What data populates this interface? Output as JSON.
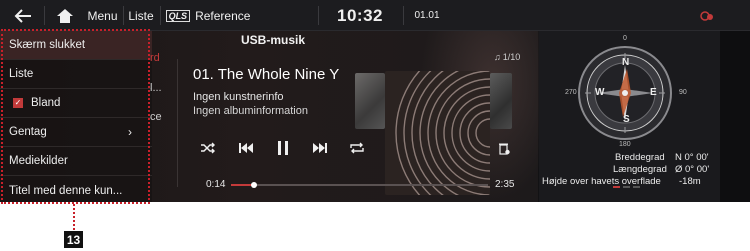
{
  "topbar": {
    "menu_label": "Menu",
    "list_label": "Liste",
    "qls_badge": "QLS",
    "reference_label": "Reference",
    "clock": "10:32",
    "date": "01.01",
    "back_icon": "back-arrow-icon",
    "home_icon": "home-icon",
    "connectivity_icon": "connectivity-status-icon"
  },
  "media": {
    "source_title": "USB-musik",
    "track_count": "1/10",
    "track_title": "01. The Whole Nine Y",
    "artist": "Ingen kunstnerinfo",
    "album": "Ingen albuminformation",
    "elapsed": "0:14",
    "duration": "2:35",
    "progress_fraction": 0.09,
    "controls": [
      "shuffle-icon",
      "previous-icon",
      "pause-icon",
      "next-icon",
      "repeat-icon",
      "delete-icon"
    ]
  },
  "menu": {
    "items": [
      {
        "label": "Skærm slukket",
        "active": true
      },
      {
        "label": "Liste"
      },
      {
        "label": "Bland",
        "checked": true
      },
      {
        "label": "Gentag",
        "chevron": "›"
      },
      {
        "label": "Mediekilder"
      },
      {
        "label": "Titel med denne kun..."
      }
    ],
    "peek": [
      "rd",
      "l...",
      "ce"
    ]
  },
  "compass": {
    "north": "N",
    "south": "S",
    "east": "E",
    "west": "W",
    "degrees": [
      "0",
      "90",
      "180",
      "270"
    ],
    "latitude_label": "Breddegrad",
    "latitude_value": "N 0° 00'",
    "longitude_label": "Længdegrad",
    "longitude_value": "Ø 0° 00'",
    "altitude_label": "Højde over havets overflade",
    "altitude_value": "-18m"
  },
  "callout_number": "13",
  "colors": {
    "accent": "#c23a3a",
    "callout_border": "#c8202a",
    "screen_bg": "#121214"
  }
}
